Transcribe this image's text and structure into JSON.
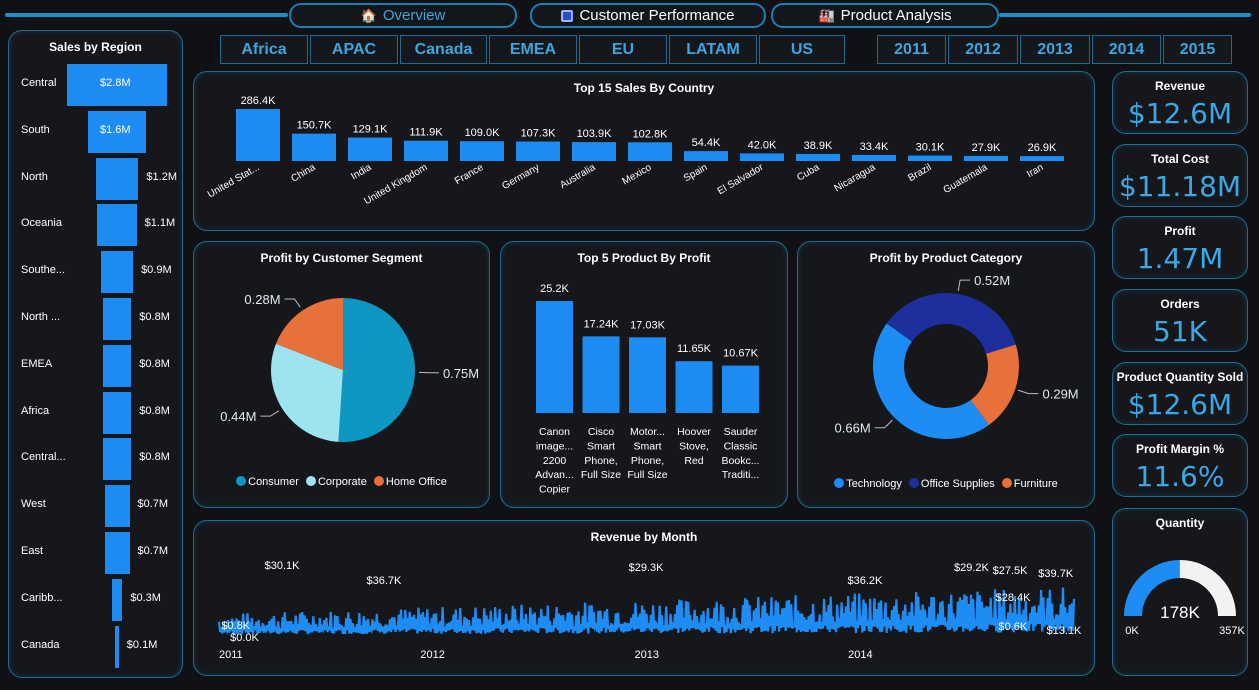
{
  "nav": {
    "tabs": [
      {
        "label": "Overview",
        "icon": "home-icon",
        "active": true
      },
      {
        "label": "Customer Performance",
        "icon": "customer-icon",
        "active": false
      },
      {
        "label": "Product Analysis",
        "icon": "product-icon",
        "active": false
      }
    ]
  },
  "filters": {
    "regions": [
      "Africa",
      "APAC",
      "Canada",
      "EMEA",
      "EU",
      "LATAM",
      "US"
    ],
    "years": [
      "2011",
      "2012",
      "2013",
      "2014",
      "2015"
    ]
  },
  "colors": {
    "bar": "#1e8cf5",
    "accent": "#3aa8e6",
    "border": "#1d6b92",
    "pie_consumer": "#0e97c2",
    "pie_corporate": "#9ee3f0",
    "pie_home_office": "#e8703a",
    "donut_technology": "#1e8cf5",
    "donut_office_supplies": "#1c2f9c",
    "donut_furniture": "#e8703a",
    "gauge_fill": "#1e8cf5",
    "gauge_track": "#f2f2f2"
  },
  "sales_by_region": {
    "title": "Sales by Region",
    "chart_data": {
      "type": "bar",
      "orientation": "horizontal",
      "categories": [
        "Central",
        "South",
        "North",
        "Oceania",
        "Southe...",
        "North ...",
        "EMEA",
        "Africa",
        "Central...",
        "West",
        "East",
        "Caribb...",
        "Canada"
      ],
      "values": [
        2.8,
        1.6,
        1.2,
        1.1,
        0.9,
        0.8,
        0.8,
        0.8,
        0.8,
        0.7,
        0.7,
        0.3,
        0.1
      ],
      "labels": [
        "$2.8M",
        "$1.6M",
        "$1.2M",
        "$1.1M",
        "$0.9M",
        "$0.8M",
        "$0.8M",
        "$0.8M",
        "$0.8M",
        "$0.7M",
        "$0.7M",
        "$0.3M",
        "$0.1M"
      ],
      "unit": "$M"
    }
  },
  "top_countries": {
    "title": "Top 15 Sales By Country",
    "chart_data": {
      "type": "bar",
      "categories": [
        "United Stat...",
        "China",
        "India",
        "United Kingdom",
        "France",
        "Germany",
        "Australia",
        "Mexico",
        "Spain",
        "El Salvador",
        "Cuba",
        "Nicaragua",
        "Brazil",
        "Guatemala",
        "Iran"
      ],
      "values": [
        286.4,
        150.7,
        129.1,
        111.9,
        109.0,
        107.3,
        103.9,
        102.8,
        54.4,
        42.0,
        38.9,
        33.4,
        30.1,
        27.9,
        26.9
      ],
      "labels": [
        "286.4K",
        "150.7K",
        "129.1K",
        "111.9K",
        "109.0K",
        "107.3K",
        "103.9K",
        "102.8K",
        "54.4K",
        "42.0K",
        "38.9K",
        "33.4K",
        "30.1K",
        "27.9K",
        "26.9K"
      ],
      "unit": "K"
    }
  },
  "profit_by_segment": {
    "title": "Profit by Customer Segment",
    "chart_data": {
      "type": "pie",
      "categories": [
        "Consumer",
        "Corporate",
        "Home Office"
      ],
      "values": [
        0.75,
        0.44,
        0.28
      ],
      "labels": [
        "0.75M",
        "0.44M",
        "0.28M"
      ],
      "legend": "bottom"
    }
  },
  "top_products": {
    "title": "Top 5 Product By Profit",
    "chart_data": {
      "type": "bar",
      "categories": [
        [
          "Canon",
          "image...",
          "2200",
          "Advan...",
          "Copier"
        ],
        [
          "Cisco",
          "Smart",
          "Phone,",
          "Full Size"
        ],
        [
          "Motor...",
          "Smart",
          "Phone,",
          "Full Size"
        ],
        [
          "Hoover",
          "Stove,",
          "Red"
        ],
        [
          "Sauder",
          "Classic",
          "Bookc...",
          "Traditi..."
        ]
      ],
      "values": [
        25.2,
        17.24,
        17.03,
        11.65,
        10.67
      ],
      "labels": [
        "25.2K",
        "17.24K",
        "17.03K",
        "11.65K",
        "10.67K"
      ],
      "unit": "K"
    }
  },
  "profit_by_category": {
    "title": "Profit by Product Category",
    "chart_data": {
      "type": "pie",
      "variant": "donut",
      "categories": [
        "Technology",
        "Office Supplies",
        "Furniture"
      ],
      "values": [
        0.66,
        0.52,
        0.29
      ],
      "labels": [
        "0.66M",
        "0.52M",
        "0.29M"
      ],
      "legend": "bottom"
    }
  },
  "kpis": [
    {
      "title": "Revenue",
      "value": "$12.6M"
    },
    {
      "title": "Total Cost",
      "value": "$11.18M"
    },
    {
      "title": "Profit",
      "value": "1.47M"
    },
    {
      "title": "Orders",
      "value": "51K"
    },
    {
      "title": "Product Quantity Sold",
      "value": "$12.6M"
    },
    {
      "title": "Profit Margin %",
      "value": "11.6%"
    }
  ],
  "quantity_gauge": {
    "title": "Quantity",
    "value_label": "178K",
    "min_label": "0K",
    "max_label": "357K",
    "value": 178,
    "min": 0,
    "max": 357
  },
  "revenue_by_month": {
    "title": "Revenue by Month",
    "chart_data": {
      "type": "line",
      "x_ticks": [
        "2011",
        "2012",
        "2013",
        "2014"
      ],
      "xlim": [
        "2011-01",
        "2015-01"
      ],
      "annotations": [
        {
          "x": "2011-01-05",
          "label": "$0.8K"
        },
        {
          "x": "2011-01-20",
          "label": "$0.0K"
        },
        {
          "x": "2011-03-20",
          "label": "$30.1K"
        },
        {
          "x": "2011-09-10",
          "label": "$36.7K"
        },
        {
          "x": "2012-12-01",
          "label": "$29.3K"
        },
        {
          "x": "2013-12-10",
          "label": "$36.2K"
        },
        {
          "x": "2014-06-10",
          "label": "$29.2K"
        },
        {
          "x": "2014-08-15",
          "label": "$27.5K"
        },
        {
          "x": "2014-08-20",
          "label": "$28.4K"
        },
        {
          "x": "2014-08-25",
          "label": "$0.6K"
        },
        {
          "x": "2014-11-01",
          "label": "$39.7K"
        },
        {
          "x": "2014-11-15",
          "label": "$13.1K"
        }
      ]
    }
  }
}
